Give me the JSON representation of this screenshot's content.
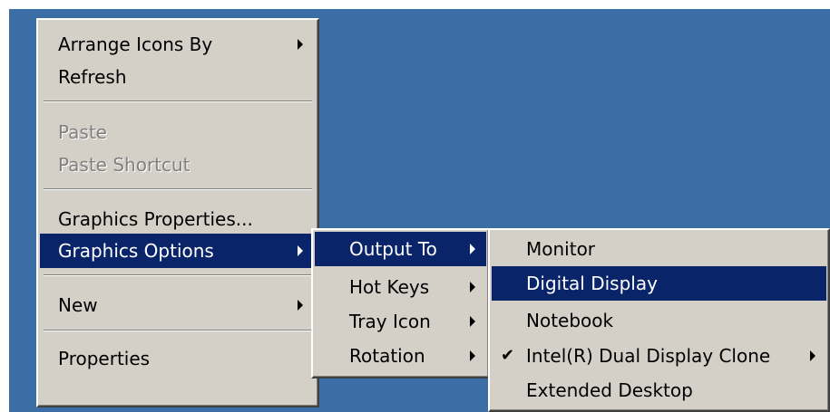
{
  "colors": {
    "desktop": "#3a6ea5",
    "menu_bg": "#d4d0c8",
    "selection": "#0a246a",
    "disabled_text": "#808080"
  },
  "context_menu": {
    "arrange_icons_by": "Arrange Icons By",
    "refresh": "Refresh",
    "paste": "Paste",
    "paste_shortcut": "Paste Shortcut",
    "graphics_properties": "Graphics Properties...",
    "graphics_options": "Graphics Options",
    "new": "New",
    "properties": "Properties"
  },
  "graphics_options_menu": {
    "output_to": "Output To",
    "hot_keys": "Hot Keys",
    "tray_icon": "Tray Icon",
    "rotation": "Rotation"
  },
  "output_to_menu": {
    "monitor": "Monitor",
    "digital_display": "Digital Display",
    "notebook": "Notebook",
    "dual_display_clone": "Intel(R) Dual Display Clone",
    "extended_desktop": "Extended Desktop",
    "check_glyph": "✔"
  },
  "icons": [
    "submenu-arrow-icon",
    "checkmark-icon"
  ]
}
